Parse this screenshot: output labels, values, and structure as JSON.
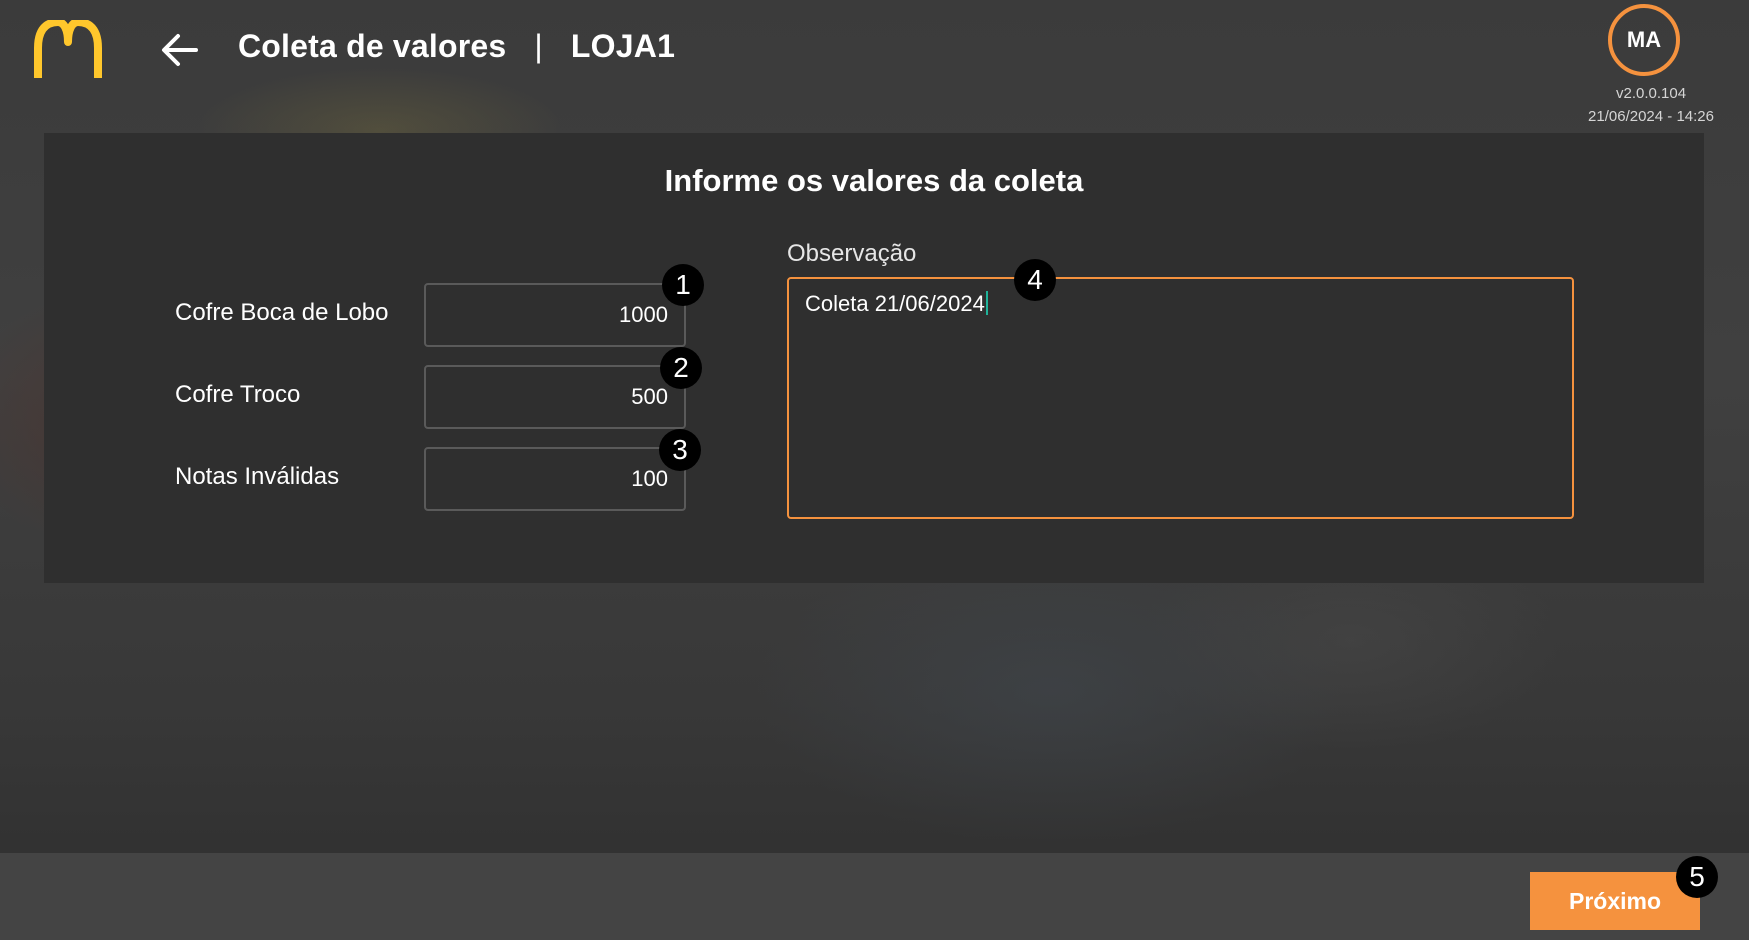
{
  "header": {
    "title": "Coleta de valores",
    "separator": "|",
    "store": "LOJA1",
    "avatar_initials": "MA",
    "version": "v2.0.0.104",
    "datetime": "21/06/2024 - 14:26",
    "logo_icon": "golden-arches-icon",
    "back_icon": "arrow-left-icon",
    "accent_color": "#f5923e",
    "logo_color": "#ffc72c"
  },
  "form": {
    "title": "Informe os valores da coleta",
    "fields": [
      {
        "label": "Cofre Boca de Lobo",
        "value": "1000",
        "marker": "1"
      },
      {
        "label": "Cofre Troco",
        "value": "500",
        "marker": "2"
      },
      {
        "label": "Notas Inválidas",
        "value": "100",
        "marker": "3"
      }
    ],
    "observation": {
      "label": "Observação",
      "value": "Coleta 21/06/2024",
      "marker": "4"
    }
  },
  "footer": {
    "next_label": "Próximo",
    "marker": "5"
  }
}
